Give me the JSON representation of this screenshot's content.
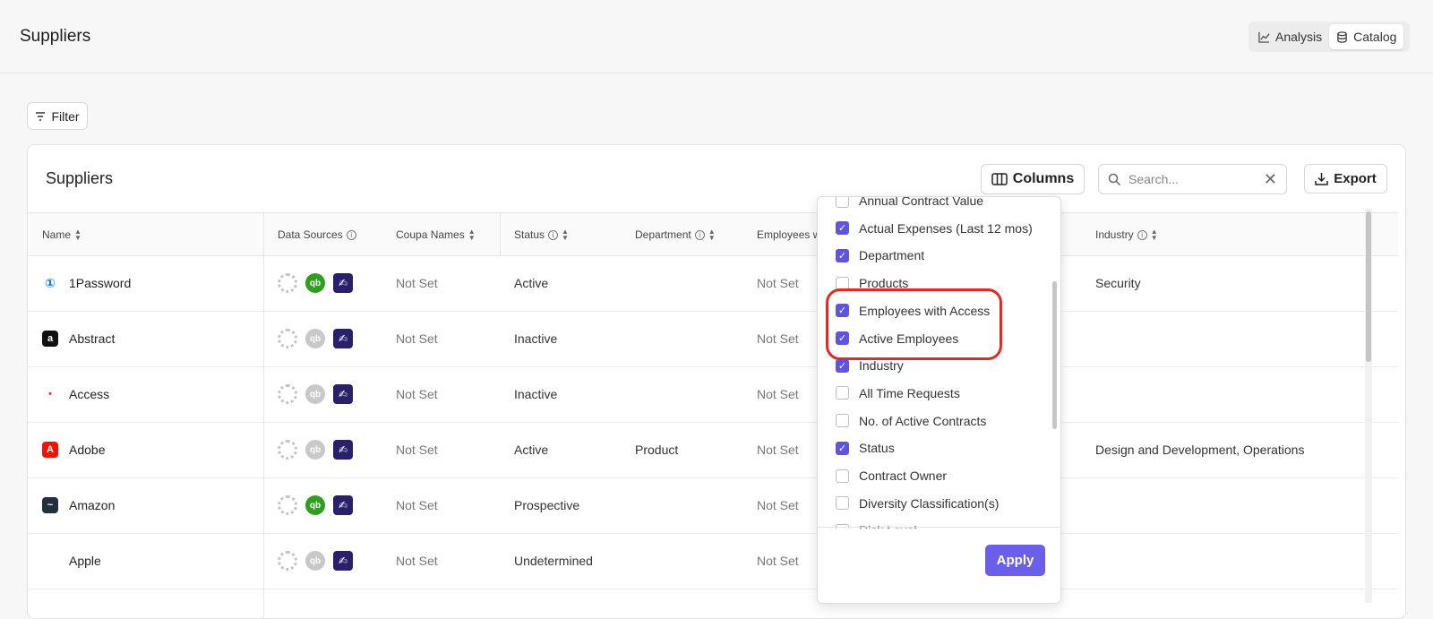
{
  "header": {
    "title": "Suppliers",
    "analysis_label": "Analysis",
    "catalog_label": "Catalog"
  },
  "toolbar": {
    "filter_label": "Filter"
  },
  "card": {
    "title": "Suppliers",
    "columns_label": "Columns",
    "search_placeholder": "Search...",
    "export_label": "Export"
  },
  "table": {
    "headers": {
      "name": "Name",
      "data_sources": "Data Sources",
      "coupa_names": "Coupa Names",
      "status": "Status",
      "department": "Department",
      "employees": "Employees w",
      "industry": "Industry"
    },
    "rows": [
      {
        "name": "1Password",
        "coupa": "Not Set",
        "status": "Active",
        "department": "",
        "employees": "Not Set",
        "industry": "Security",
        "logo": "1password-icon",
        "logo_color": "#0572ec",
        "qb": "on"
      },
      {
        "name": "Abstract",
        "coupa": "Not Set",
        "status": "Inactive",
        "department": "",
        "employees": "Not Set",
        "industry": "",
        "logo": "abstract-icon",
        "logo_color": "#111111",
        "qb": "off"
      },
      {
        "name": "Access",
        "coupa": "Not Set",
        "status": "Inactive",
        "department": "",
        "employees": "Not Set",
        "industry": "",
        "logo": "access-icon",
        "logo_color": "#e33c3c",
        "qb": "off"
      },
      {
        "name": "Adobe",
        "coupa": "Not Set",
        "status": "Active",
        "department": "Product",
        "employees": "Not Set",
        "industry": "Design and Development, Operations",
        "logo": "adobe-icon",
        "logo_color": "#fa0f00",
        "qb": "off"
      },
      {
        "name": "Amazon",
        "coupa": "Not Set",
        "status": "Prospective",
        "department": "",
        "employees": "Not Set",
        "industry": "",
        "logo": "amazon-icon",
        "logo_color": "#232f3e",
        "qb": "on"
      },
      {
        "name": "Apple",
        "coupa": "Not Set",
        "status": "Undetermined",
        "department": "",
        "employees": "Not Set",
        "industry": "",
        "logo": "apple-icon",
        "logo_color": "#555555",
        "qb": "off"
      }
    ]
  },
  "columns_menu": {
    "apply_label": "Apply",
    "items": [
      {
        "label": "Annual Contract Value",
        "checked": false
      },
      {
        "label": "Actual Expenses (Last 12 mos)",
        "checked": true
      },
      {
        "label": "Department",
        "checked": true
      },
      {
        "label": "Products",
        "checked": false
      },
      {
        "label": "Employees with Access",
        "checked": true
      },
      {
        "label": "Active Employees",
        "checked": true
      },
      {
        "label": "Industry",
        "checked": true
      },
      {
        "label": "All Time Requests",
        "checked": false
      },
      {
        "label": "No. of Active Contracts",
        "checked": false
      },
      {
        "label": "Status",
        "checked": true
      },
      {
        "label": "Contract Owner",
        "checked": false
      },
      {
        "label": "Diversity Classification(s)",
        "checked": false
      },
      {
        "label": "Risk Level",
        "checked": false
      }
    ]
  }
}
